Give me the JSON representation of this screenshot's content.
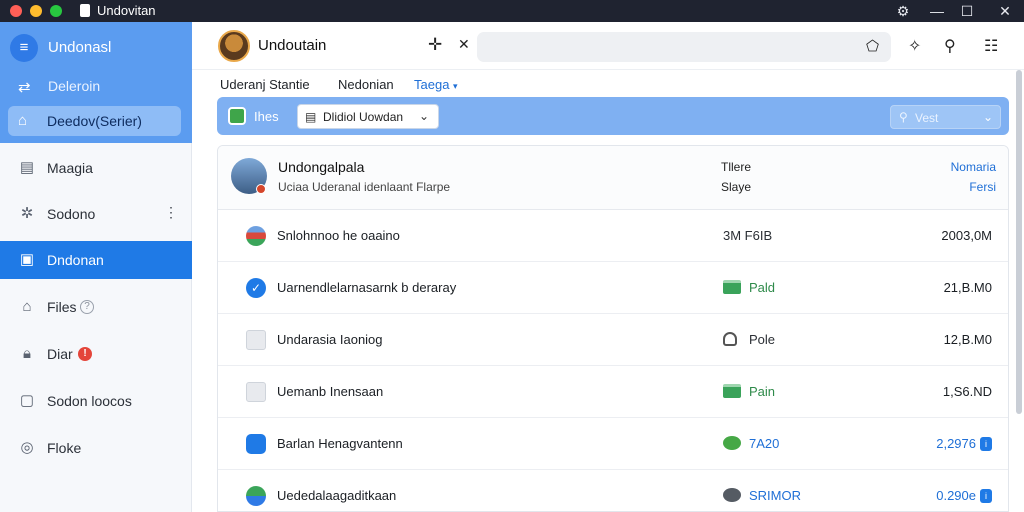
{
  "window": {
    "title": "Undovitan"
  },
  "sidebar": {
    "brand": "Undonasl",
    "section": "Deleroin",
    "active_top": "Deedov(Serier)",
    "items": [
      {
        "label": "Maagia",
        "icon": "inbox-icon"
      },
      {
        "label": "Sodono",
        "icon": "settings-icon"
      },
      {
        "label": "Dndonan",
        "icon": "book-icon"
      },
      {
        "label": "Files",
        "icon": "file-icon"
      },
      {
        "label": "Diar",
        "icon": "lock-icon"
      },
      {
        "label": "Sodon loocos",
        "icon": "note-icon"
      },
      {
        "label": "Floke",
        "icon": "globe-icon"
      }
    ],
    "alert_mark": "!",
    "help_mark": "?"
  },
  "header": {
    "title": "Undoutain"
  },
  "subtabs": [
    {
      "label": "Uderanj Stantie"
    },
    {
      "label": "Nedonian"
    },
    {
      "label": "Taega"
    }
  ],
  "toolbar": {
    "label": "Ihes",
    "select_value": "Dlidiol Uowdan",
    "search_placeholder": "Vest"
  },
  "list_header": {
    "title": "Undongalpala",
    "subtitle": "Uciaa Uderanal idenlaant Flarpe",
    "col1_a": "Tllere",
    "col1_b": "Slaye",
    "col2_a": "Nomaria",
    "col2_b": "Fersi"
  },
  "rows": [
    {
      "name": "Snlohnnoo he oaaino",
      "status": "3M F6IB",
      "size": "2003,0M",
      "status_color": "default",
      "size_color": "default"
    },
    {
      "name": "Uarnendlelarnasarnk b deraray",
      "status": "Pald",
      "size": "21,B.M0",
      "status_color": "green",
      "size_color": "default"
    },
    {
      "name": "Undarasia Iaoniog",
      "status": "Pole",
      "size": "12,B.M0",
      "status_color": "default",
      "size_color": "default"
    },
    {
      "name": "Uemanb Inensaan",
      "status": "Pain",
      "size": "1,S6.ND",
      "status_color": "green",
      "size_color": "default"
    },
    {
      "name": "Barlan Henagvantenn",
      "status": "7A20",
      "size": "2,2976",
      "status_color": "blue",
      "size_color": "blue"
    },
    {
      "name": "Uededalaagaditkaan",
      "status": "SRIMOR",
      "size": "0.290e",
      "status_color": "blue",
      "size_color": "blue"
    }
  ],
  "colors": {
    "accent": "#1f7ae6",
    "sidebar_header": "#5b9cf0",
    "toolbar": "#7fb0f2",
    "titlebar": "#1f2330"
  }
}
